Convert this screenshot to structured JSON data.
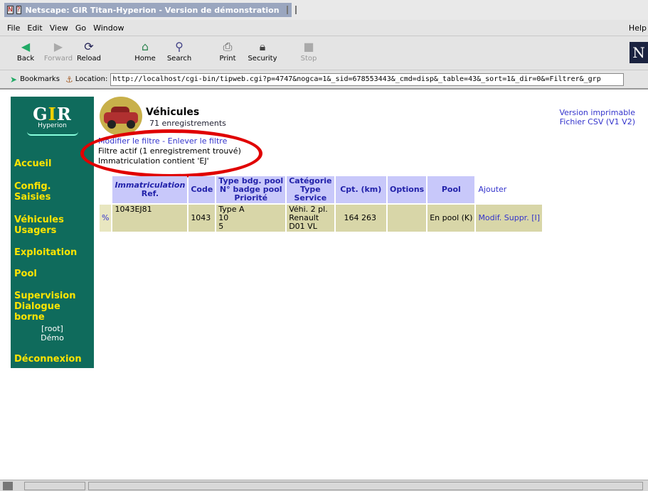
{
  "window": {
    "title": "Netscape: GIR Titan-Hyperion - Version de démonstration"
  },
  "menu": {
    "items": [
      "File",
      "Edit",
      "View",
      "Go",
      "Window"
    ],
    "help": "Help"
  },
  "toolbar": {
    "buttons": [
      {
        "label": "Back",
        "icon": "back-arrow-icon",
        "enabled": true
      },
      {
        "label": "Forward",
        "icon": "forward-arrow-icon",
        "enabled": false
      },
      {
        "label": "Reload",
        "icon": "reload-icon",
        "enabled": true
      },
      {
        "label": "Home",
        "icon": "home-icon",
        "enabled": true
      },
      {
        "label": "Search",
        "icon": "search-icon",
        "enabled": true
      },
      {
        "label": "Print",
        "icon": "print-icon",
        "enabled": true
      },
      {
        "label": "Security",
        "icon": "lock-icon",
        "enabled": true
      },
      {
        "label": "Stop",
        "icon": "stop-icon",
        "enabled": false
      }
    ],
    "logo": "N"
  },
  "location": {
    "bookmarks_label": "Bookmarks",
    "location_label": "Location:",
    "url": "http://localhost/cgi-bin/tipweb.cgi?p=4747&nogca=1&_sid=678553443&_cmd=disp&_table=43&_sort=1&_dir=0&=Filtrer&_grp"
  },
  "sidebar": {
    "logo": {
      "brand_prefix": "G",
      "brand_accent": "I",
      "brand_suffix": "R",
      "product": "Hyperion"
    },
    "items": [
      {
        "label": "Accueil"
      },
      {
        "label": "Config.",
        "label2": "Saisies"
      },
      {
        "label": "Véhicules",
        "label2": "Usagers"
      },
      {
        "label": "Exploitation"
      },
      {
        "label": "Pool"
      },
      {
        "label": "Supervision",
        "label2": "Dialogue borne"
      }
    ],
    "user": {
      "line1": "[root]",
      "line2": "Démo"
    },
    "logout": "Déconnexion"
  },
  "page": {
    "title": "Véhicules",
    "count": "71 enregistrements",
    "filter_modify": "Modifier le filtre",
    "filter_separator": " - ",
    "filter_remove": "Enlever le filtre",
    "filter_active": "Filtre actif (1 enregistrement trouvé)",
    "filter_condition": "Immatriculation contient 'EJ'",
    "print_link": "Version imprimable",
    "csv_link": "Fichier CSV (V1 V2)"
  },
  "table": {
    "headers": {
      "col1_line1": "Immatriculation",
      "col1_line2": "Ref.",
      "code": "Code",
      "col3_line1": "Type bdg. pool",
      "col3_line2": "N° badge pool",
      "col3_line3": "Priorité",
      "col4_line1": "Catégorie",
      "col4_line2": "Type",
      "col4_line3": "Service",
      "cpt": "Cpt. (km)",
      "options": "Options",
      "pool": "Pool",
      "add": "Ajouter"
    },
    "rows": [
      {
        "marker": "%",
        "ref": "1043EJ81",
        "code": "1043",
        "type_bdg": "Type A",
        "num_badge": "10",
        "priorite": "5",
        "categorie": "Véhi. 2 pl.",
        "type": "Renault",
        "service": "D01 VL",
        "cpt": "164 263",
        "options": "",
        "pool": "En pool (K)",
        "modif": "Modif.",
        "suppr": "Suppr.",
        "info": "[I]"
      }
    ]
  },
  "colors": {
    "sidebar_bg": "#0f6b5c",
    "nav_text": "#ffe400",
    "header_bg": "#c8c8fa",
    "row_bg": "#d8d6a8",
    "link": "#3333cc",
    "highlight_oval": "#e00000"
  }
}
